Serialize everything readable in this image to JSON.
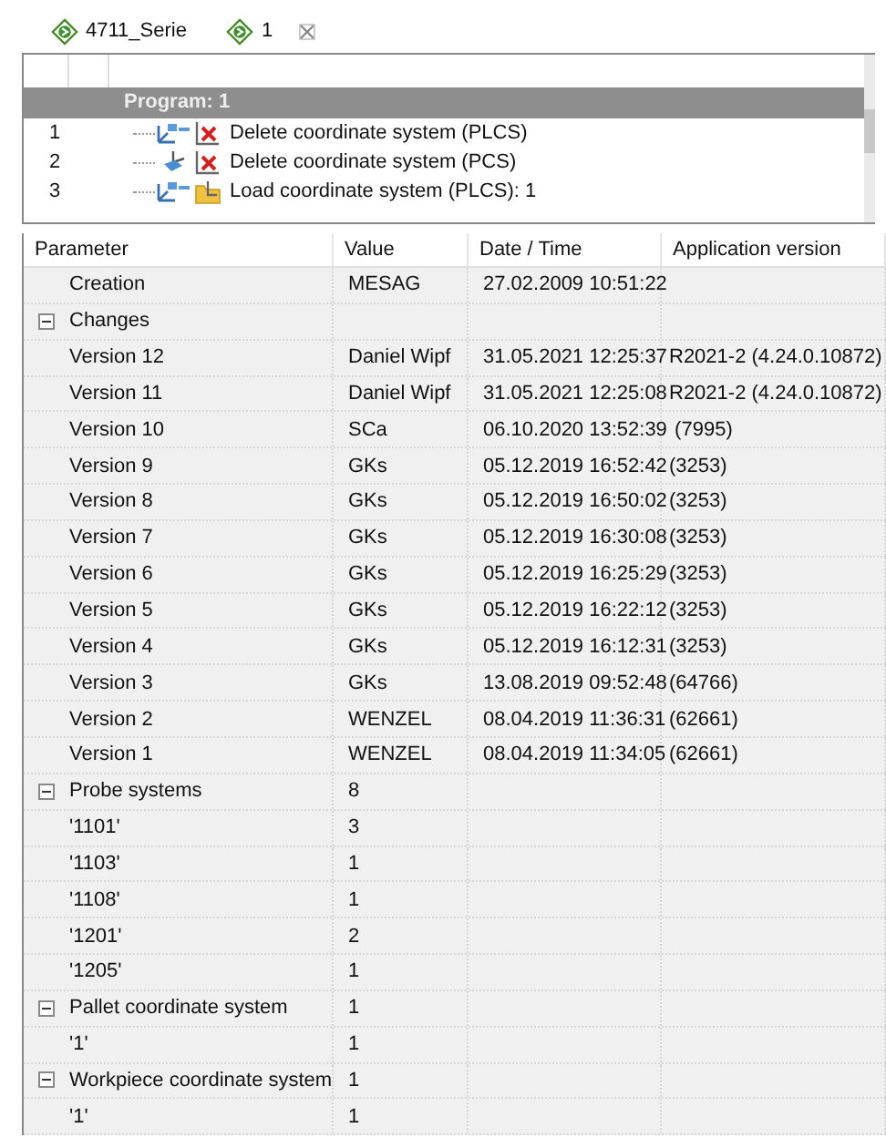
{
  "tabs": [
    {
      "label": "4711_Serie",
      "closable": false
    },
    {
      "label": "1",
      "closable": true
    }
  ],
  "program": {
    "header": "Program: 1",
    "steps": [
      {
        "number": "1",
        "kind": "delete_plcs",
        "label": "Delete coordinate system (PLCS)"
      },
      {
        "number": "2",
        "kind": "delete_pcs",
        "label": "Delete coordinate system (PCS)"
      },
      {
        "number": "3",
        "kind": "load_plcs",
        "label": "Load coordinate system (PLCS): 1"
      }
    ]
  },
  "table": {
    "columns": [
      "Parameter",
      "Value",
      "Date / Time",
      "Application version"
    ],
    "rows": [
      {
        "parameter": "Creation",
        "value": "MESAG",
        "date_time": "27.02.2009 10:51:22"
      },
      {
        "parameter": "Changes",
        "expanded": true,
        "children": [
          {
            "parameter": "Version 12",
            "value": "Daniel Wipf",
            "date_time": "31.05.2021 12:25:37",
            "app_version": "R2021-2 (4.24.0.10872)"
          },
          {
            "parameter": "Version 11",
            "value": "Daniel Wipf",
            "date_time": "31.05.2021 12:25:08",
            "app_version": "R2021-2 (4.24.0.10872)"
          },
          {
            "parameter": "Version 10",
            "value": "SCa",
            "date_time": "06.10.2020 13:52:39",
            "app_version": " (7995)"
          },
          {
            "parameter": "Version 9",
            "value": "GKs",
            "date_time": "05.12.2019 16:52:42",
            "app_version": "(3253)"
          },
          {
            "parameter": "Version 8",
            "value": "GKs",
            "date_time": "05.12.2019 16:50:02",
            "app_version": "(3253)"
          },
          {
            "parameter": "Version 7",
            "value": "GKs",
            "date_time": "05.12.2019 16:30:08",
            "app_version": "(3253)"
          },
          {
            "parameter": "Version 6",
            "value": "GKs",
            "date_time": "05.12.2019 16:25:29",
            "app_version": "(3253)"
          },
          {
            "parameter": "Version 5",
            "value": "GKs",
            "date_time": "05.12.2019 16:22:12",
            "app_version": "(3253)"
          },
          {
            "parameter": "Version 4",
            "value": "GKs",
            "date_time": "05.12.2019 16:12:31",
            "app_version": "(3253)"
          },
          {
            "parameter": "Version 3",
            "value": "GKs",
            "date_time": "13.08.2019 09:52:48",
            "app_version": "(64766)"
          },
          {
            "parameter": "Version 2",
            "value": "WENZEL",
            "date_time": "08.04.2019 11:36:31",
            "app_version": "(62661)"
          },
          {
            "parameter": "Version 1",
            "value": "WENZEL",
            "date_time": "08.04.2019 11:34:05",
            "app_version": "(62661)"
          }
        ]
      },
      {
        "parameter": "Probe systems",
        "value": "8",
        "expanded": true,
        "children": [
          {
            "parameter": "'1101'",
            "value": "3"
          },
          {
            "parameter": "'1103'",
            "value": "1"
          },
          {
            "parameter": "'1108'",
            "value": "1"
          },
          {
            "parameter": "'1201'",
            "value": "2"
          },
          {
            "parameter": "'1205'",
            "value": "1"
          }
        ]
      },
      {
        "parameter": "Pallet coordinate system",
        "value": "1",
        "expanded": true,
        "children": [
          {
            "parameter": "'1'",
            "value": "1"
          }
        ]
      },
      {
        "parameter": "Workpiece coordinate system",
        "value": "1",
        "expanded": true,
        "children": [
          {
            "parameter": "'1'",
            "value": "1"
          }
        ]
      }
    ]
  }
}
